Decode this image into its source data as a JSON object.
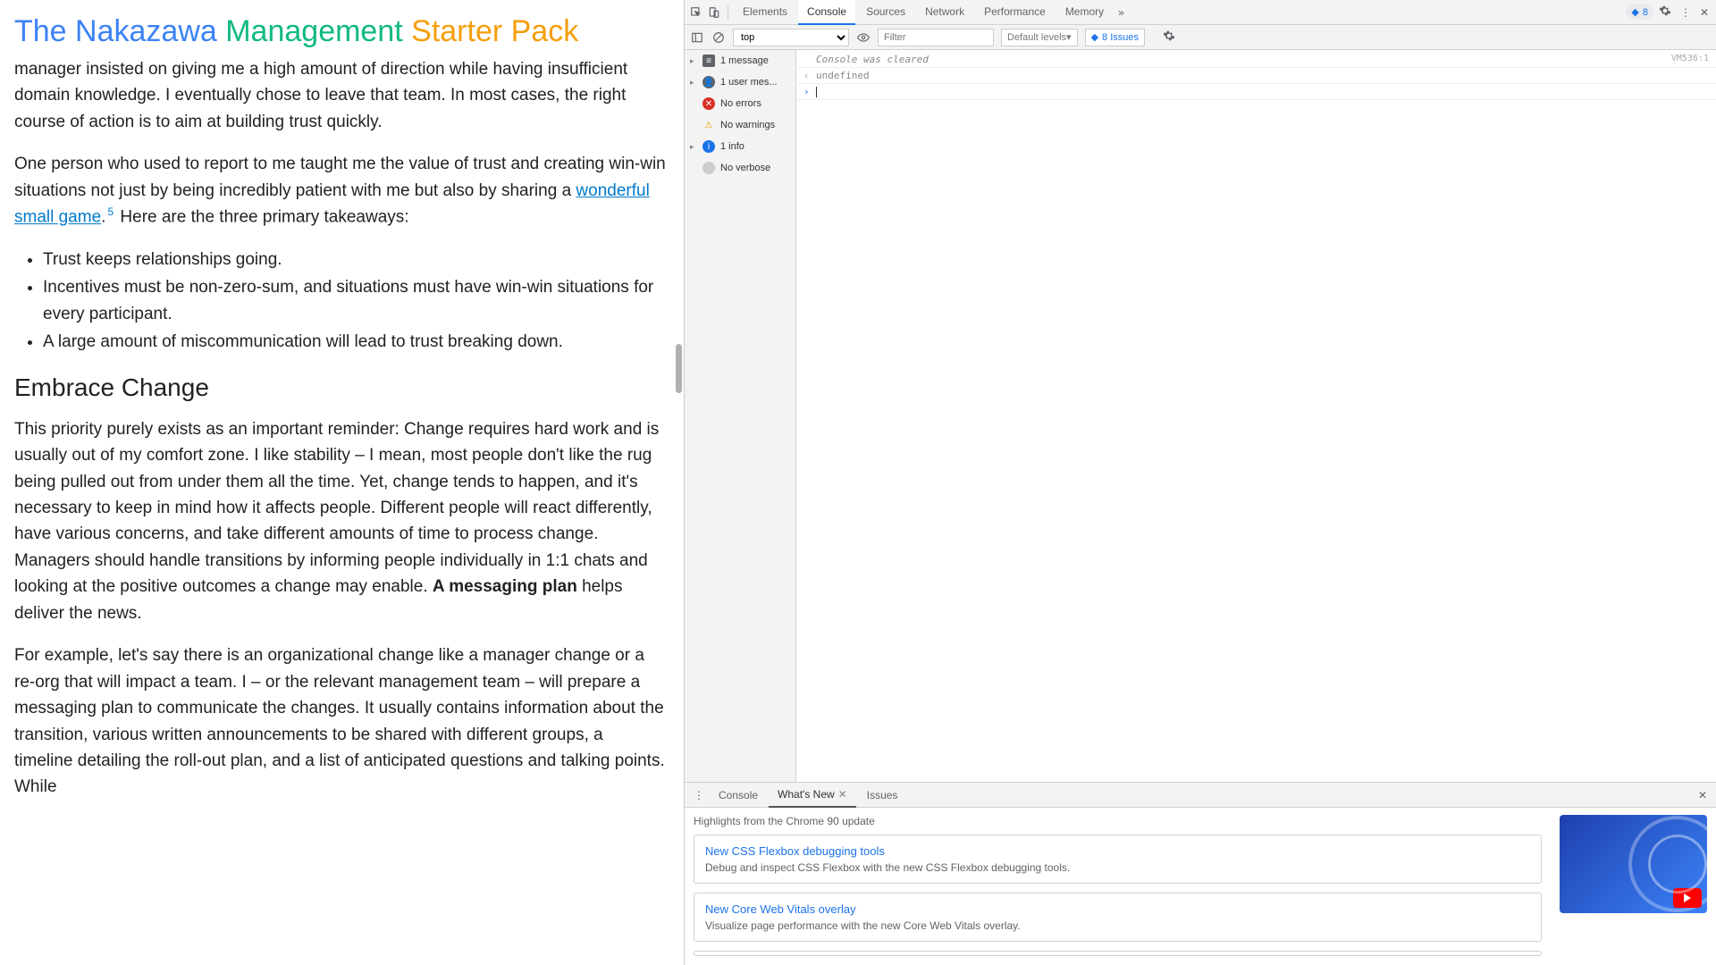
{
  "page": {
    "title_parts": [
      "The Nakazawa ",
      "Management ",
      "Starter Pack"
    ],
    "para1": "manager insisted on giving me a high amount of direction while having insufficient domain knowledge. I eventually chose to leave that team. In most cases, the right course of action is to aim at building trust quickly.",
    "para2a": "One person who used to report to me taught me the value of trust and creating win-win situations not just by being incredibly patient with me but also by sharing a ",
    "link1": "wonderful small game",
    "footnote": "5",
    "para2b": " Here are the three primary takeaways:",
    "bullets": [
      "Trust keeps relationships going.",
      "Incentives must be non-zero-sum, and situations must have win-win situations for every participant.",
      "A large amount of miscommunication will lead to trust breaking down."
    ],
    "h2": "Embrace Change",
    "para3a": "This priority purely exists as an important reminder: Change requires hard work and is usually out of my comfort zone. I like stability – I mean, most people don't like the rug being pulled out from under them all the time. Yet, change tends to happen, and it's necessary to keep in mind how it affects people. Different people will react differently, have various concerns, and take different amounts of time to process change. Managers should handle transitions by informing people individually in 1:1 chats and looking at the positive outcomes a change may enable. ",
    "para3b": "A messaging plan",
    "para3c": " helps deliver the news.",
    "para4": "For example, let's say there is an organizational change like a manager change or a re-org that will impact a team. I – or the relevant management team – will prepare a messaging plan to communicate the changes. It usually contains information about the transition, various written announcements to be shared with different groups, a timeline detailing the roll-out plan, and a list of anticipated questions and talking points. While"
  },
  "devtools": {
    "tabs": [
      "Elements",
      "Console",
      "Sources",
      "Network",
      "Performance",
      "Memory"
    ],
    "active_tab": "Console",
    "warn_count": "8",
    "context": "top",
    "filter_placeholder": "Filter",
    "levels": "Default levels",
    "issues_label": "8 Issues",
    "sidebar": [
      {
        "label": "1 message",
        "icon": "msg",
        "tri": true
      },
      {
        "label": "1 user mes...",
        "icon": "user",
        "tri": true
      },
      {
        "label": "No errors",
        "icon": "err",
        "tri": false
      },
      {
        "label": "No warnings",
        "icon": "warn",
        "tri": false
      },
      {
        "label": "1 info",
        "icon": "info",
        "tri": true
      },
      {
        "label": "No verbose",
        "icon": "verb",
        "tri": false
      }
    ],
    "console_cleared": "Console was cleared",
    "console_cleared_src": "VM536:1",
    "undefined": "undefined"
  },
  "drawer": {
    "tabs": [
      "Console",
      "What's New",
      "Issues"
    ],
    "active": "What's New",
    "headline": "Highlights from the Chrome 90 update",
    "cards": [
      {
        "title": "New CSS Flexbox debugging tools",
        "sub": "Debug and inspect CSS Flexbox with the new CSS Flexbox debugging tools."
      },
      {
        "title": "New Core Web Vitals overlay",
        "sub": "Visualize page performance with the new Core Web Vitals overlay."
      }
    ]
  }
}
